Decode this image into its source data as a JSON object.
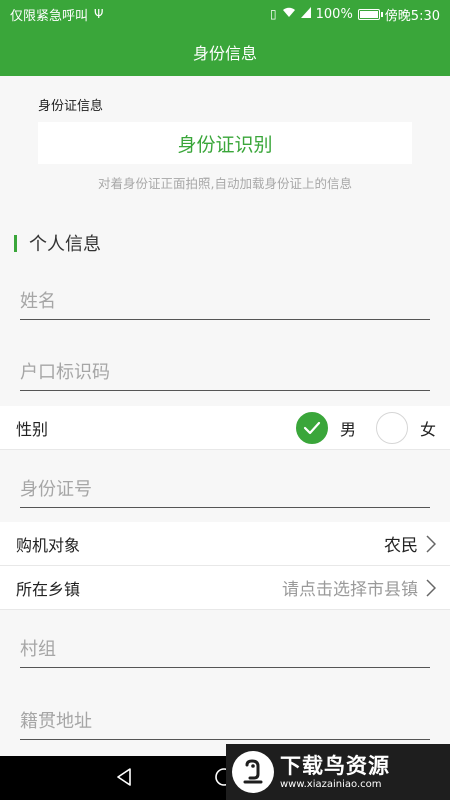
{
  "status_bar": {
    "carrier": "仅限紧急呼叫",
    "battery": "100%",
    "battery_level": 1.0,
    "time": "傍晚5:30"
  },
  "app_bar": {
    "title": "身份信息"
  },
  "id_card": {
    "label": "身份证信息",
    "button": "身份证识别",
    "hint": "对着身份证正面拍照,自动加载身份证上的信息"
  },
  "personal": {
    "title": "个人信息",
    "name_placeholder": "姓名",
    "household_placeholder": "户口标识码",
    "gender_label": "性别",
    "gender_male": "男",
    "gender_female": "女",
    "gender_selected": "男",
    "id_number_placeholder": "身份证号",
    "buyer_label": "购机对象",
    "buyer_value": "农民",
    "town_label": "所在乡镇",
    "town_placeholder": "请点击选择市县镇",
    "village_placeholder": "村组",
    "native_placeholder": "籍贯地址"
  },
  "watermark": {
    "title": "下载鸟资源",
    "url": "www.xiazainiao.com"
  },
  "colors": {
    "accent": "#3aa63a",
    "background": "#f7f7f7",
    "placeholder": "#a6a6a6"
  },
  "icons": [
    "usb-icon",
    "vibrate-icon",
    "wifi-icon",
    "signal-icon",
    "battery-icon",
    "check-icon",
    "chevron-right-icon",
    "back-icon",
    "home-icon",
    "bird-logo-icon"
  ]
}
